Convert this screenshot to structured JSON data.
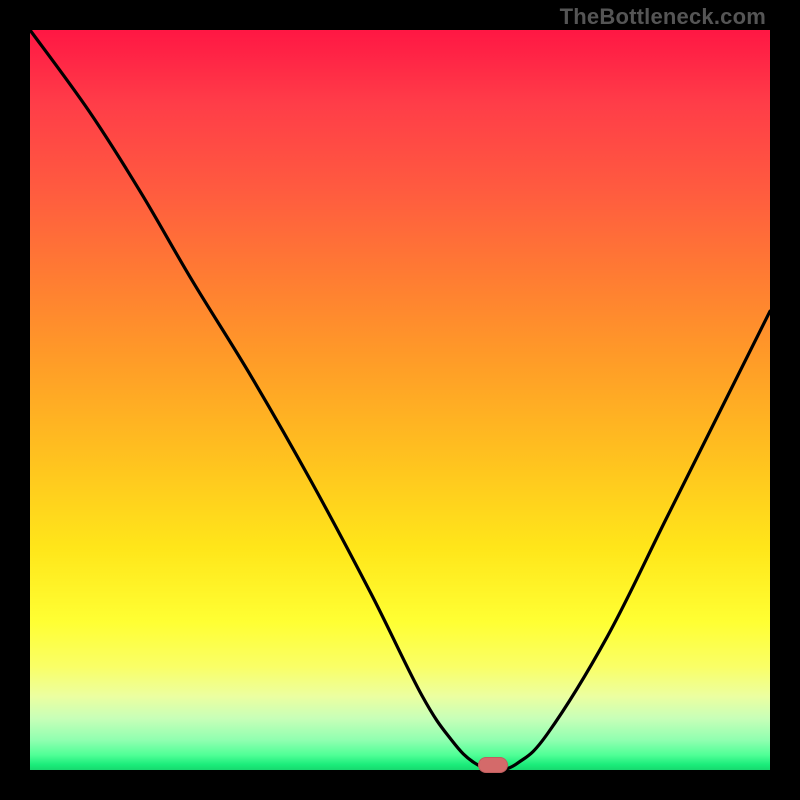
{
  "watermark": "TheBottleneck.com",
  "marker": {
    "x_pct": 62.5,
    "y_pct": 99.3
  },
  "chart_data": {
    "type": "line",
    "title": "",
    "xlabel": "",
    "ylabel": "",
    "xlim": [
      0,
      100
    ],
    "ylim": [
      0,
      100
    ],
    "series": [
      {
        "name": "bottleneck-curve",
        "x": [
          0,
          8,
          15,
          22,
          30,
          38,
          46,
          53,
          57,
          60,
          63,
          66,
          70,
          78,
          86,
          94,
          100
        ],
        "values": [
          100,
          89,
          78,
          66,
          53,
          39,
          24,
          10,
          4,
          1,
          0,
          1,
          5,
          18,
          34,
          50,
          62
        ]
      }
    ],
    "annotations": [
      {
        "type": "marker",
        "x": 62.5,
        "y": 0.7,
        "label": "selected-point"
      }
    ],
    "grid": false,
    "legend": false,
    "background_gradient": {
      "top": "#ff1744",
      "mid": "#ffe61a",
      "bottom": "#18d86f"
    }
  }
}
